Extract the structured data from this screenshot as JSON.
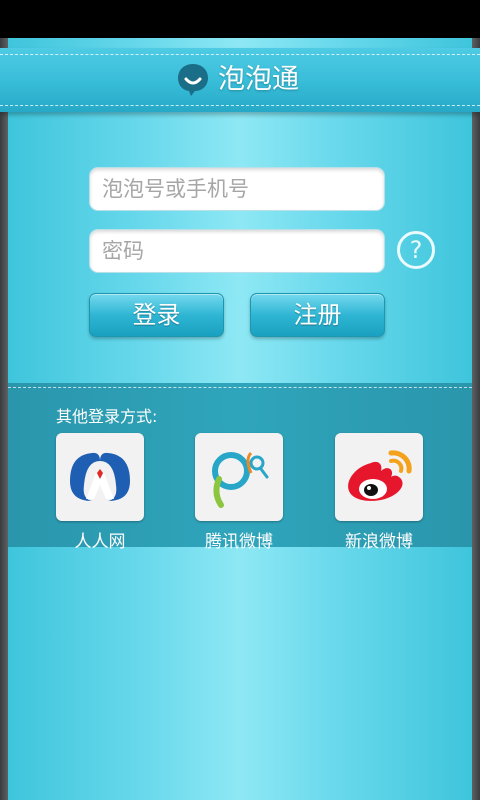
{
  "app": {
    "title": "泡泡通"
  },
  "login": {
    "account_placeholder": "泡泡号或手机号",
    "password_placeholder": "密码",
    "help_label": "?",
    "login_label": "登录",
    "register_label": "注册"
  },
  "other_login": {
    "label": "其他登录方式:",
    "providers": [
      {
        "name": "人人网",
        "icon": "renren-icon"
      },
      {
        "name": "腾讯微博",
        "icon": "tencent-weibo-icon"
      },
      {
        "name": "新浪微博",
        "icon": "sina-weibo-icon"
      }
    ]
  },
  "colors": {
    "accent": "#37bcd8",
    "panel": "#2a96ac",
    "button": "#2fb6d4"
  }
}
